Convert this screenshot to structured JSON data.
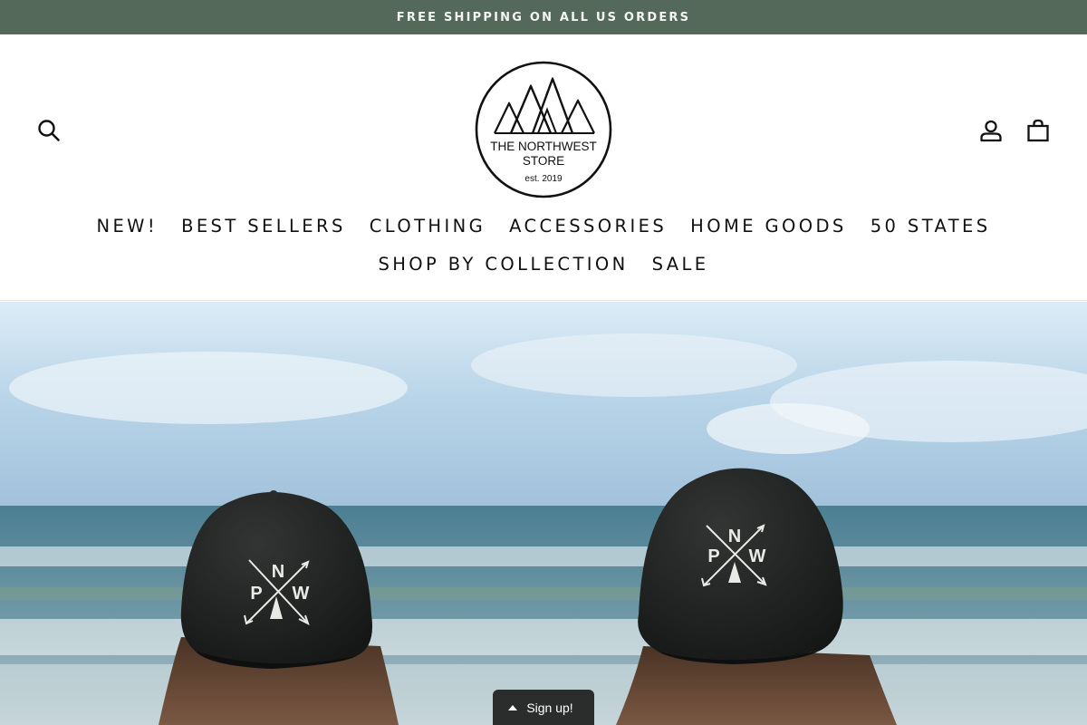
{
  "announcement": {
    "text": "FREE SHIPPING ON ALL US ORDERS"
  },
  "header": {
    "logo": {
      "line1": "THE NORTHWEST",
      "line2": "STORE",
      "line3": "est. 2019"
    },
    "icons": {
      "search": "search-icon",
      "account": "user-icon",
      "cart": "shopping-bag-icon"
    }
  },
  "nav": {
    "row1": [
      "NEW!",
      "BEST SELLERS",
      "CLOTHING",
      "ACCESSORIES",
      "HOME GOODS",
      "50 STATES"
    ],
    "row2": [
      "SHOP BY COLLECTION",
      "SALE"
    ]
  },
  "hero": {
    "cap_left": {
      "letters": [
        "N",
        "P",
        "W"
      ]
    },
    "cap_right": {
      "letters": [
        "N",
        "P",
        "W"
      ]
    }
  },
  "signup": {
    "label": "Sign up!"
  },
  "colors": {
    "announcement_bg": "#55695b",
    "signup_bg": "#2b2d2c"
  }
}
